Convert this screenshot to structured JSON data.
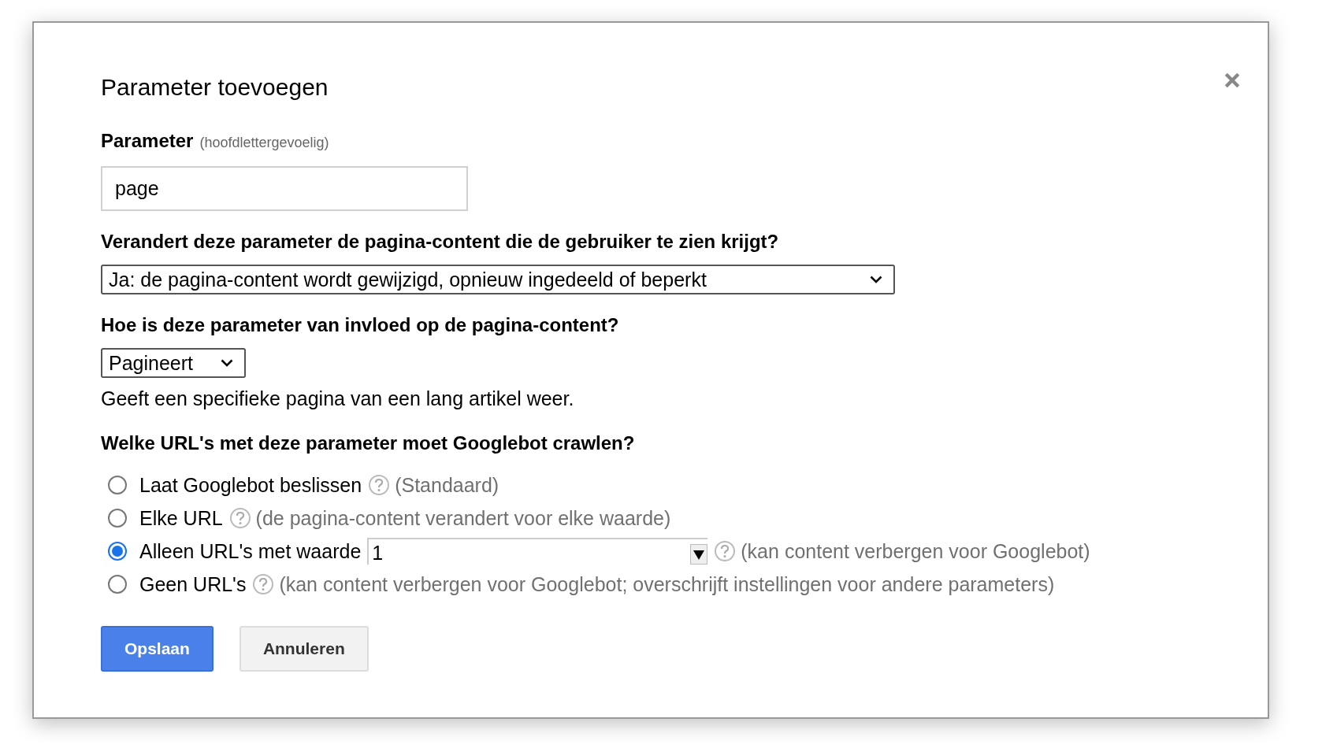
{
  "dialog": {
    "title": "Parameter toevoegen"
  },
  "parameter": {
    "label": "Parameter",
    "hint": "(hoofdlettergevoelig)",
    "value": "page"
  },
  "question_1": {
    "label": "Verandert deze parameter de pagina-content die de gebruiker te zien krijgt?",
    "selection": "Ja: de pagina-content wordt gewijzigd, opnieuw ingedeeld of beperkt"
  },
  "question_2": {
    "label": "Hoe is deze parameter van invloed op de pagina-content?",
    "selection": "Pagineert",
    "description": "Geeft een specifieke pagina van een lang artikel weer."
  },
  "question_3": {
    "label": "Welke URL's met deze parameter moet Googlebot crawlen?",
    "options": [
      {
        "label": "Laat Googlebot beslissen",
        "note": "(Standaard)",
        "selected": false
      },
      {
        "label": "Elke URL",
        "note": "(de pagina-content verandert voor elke waarde)",
        "selected": false
      },
      {
        "label": "Alleen URL's met waarde",
        "value": "1",
        "note": "(kan content verbergen voor Googlebot)",
        "selected": true
      },
      {
        "label": "Geen URL's",
        "note": "(kan content verbergen voor Googlebot; overschrijft instellingen voor andere parameters)",
        "selected": false
      }
    ]
  },
  "buttons": [
    {
      "label": "Opslaan",
      "kind": "primary"
    },
    {
      "label": "Annuleren",
      "kind": "secondary"
    }
  ]
}
